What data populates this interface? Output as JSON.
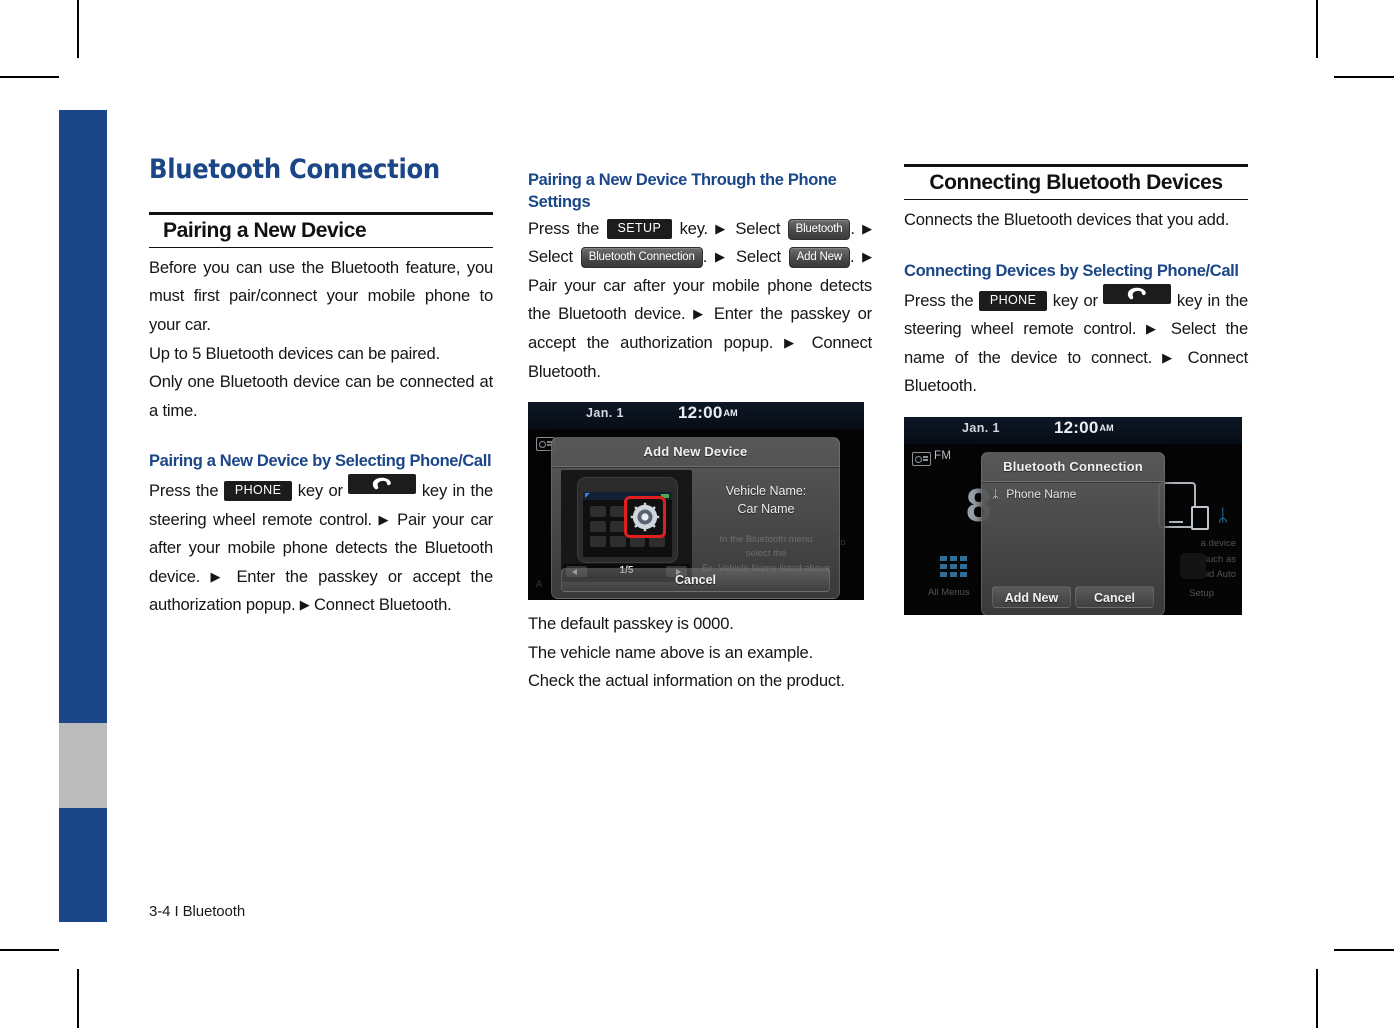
{
  "page": {
    "footer": "3-4 I Bluetooth",
    "accent_blue": "#1b4687",
    "marker_gray": "#bcbcbc"
  },
  "col1": {
    "chapter_title": "Bluetooth Connection",
    "section_title": "Pairing a New Device",
    "intro_p1": "Before you can use the Bluetooth feature, you must first pair/connect your mobile phone to your car.",
    "intro_p2": "Up to 5 Bluetooth devices can be paired.",
    "intro_p3": "Only one Bluetooth device can be connected at a time.",
    "sub_head": "Pairing a New Device by Selecting Phone/Call",
    "steps": {
      "press_the": "Press the ",
      "phone_key": "PHONE",
      "key_or": " key or ",
      "call_icon": "phone-handset-icon",
      "key_in_rest": " key in the steering wheel remote  control. ",
      "arrow": "▶",
      "step2": " Pair your car after your mobile phone detects the Bluetooth device. ",
      "step3": " Enter the passkey or accept the authorization popup. ",
      "step4": " Connect Bluetooth."
    }
  },
  "col2": {
    "sub_head": "Pairing a New Device Through the Phone Settings",
    "steps": {
      "press_the": "Press the ",
      "setup_key": "SETUP",
      "key_select": " key. ",
      "arrow": "▶",
      "select1": " Select ",
      "bluetooth_badge": "Bluetooth",
      "dot1": ". ",
      "select2": " Select ",
      "bt_connection_badge": "Bluetooth Connection",
      "dot2": ". ",
      "select3": " Select ",
      "add_new_badge": "Add New",
      "dot3": ". ",
      "step_pair": " Pair your car after your mobile phone detects the Bluetooth device. ",
      "step_passkey": " Enter the passkey or accept the authorization popup. ",
      "step_connect": " Connect Bluetooth."
    },
    "screenshot": {
      "name": "add-new-device-screen",
      "status_date": "Jan.   1",
      "status_time": "12:00",
      "status_ampm": "AM",
      "modal_title": "Add New Device",
      "vehicle_label": "Vehicle Name:",
      "vehicle_value": "Car Name",
      "faded_line1": "In the Bluetooth menu",
      "faded_line2": "select the",
      "faded_line3": "Ex. Vehicle Name listed above",
      "pager": "1/5",
      "cancel": "Cancel",
      "bg_right_line1": "s",
      "bg_right_line2": "uto",
      "bg_left": "A"
    },
    "note1": "The default passkey is 0000.",
    "note2": "The vehicle name above is an example.",
    "note3": "Check the actual information on the product."
  },
  "col3": {
    "section_title": "Connecting Bluetooth Devices",
    "intro": "Connects the Bluetooth devices that you add.",
    "sub_head": "Connecting Devices by Selecting Phone/Call",
    "steps": {
      "press_the": "Press the ",
      "phone_key": "PHONE",
      "key_or": " key or ",
      "call_icon": "phone-handset-icon",
      "key_in_rest": " key in the steering wheel remote  control. ",
      "arrow": "▶",
      "step2": " Select the name of the device to connect. ",
      "step3": " Connect Bluetooth."
    },
    "screenshot": {
      "name": "bluetooth-connection-screen",
      "status_date": "Jan.   1",
      "status_time": "12:00",
      "status_ampm": "AM",
      "fm_label": "FM",
      "preset": "8",
      "modal_title": "Bluetooth Connection",
      "device_name": "Phone Name",
      "bt_glyph": "ᛦ",
      "btn_add_new": "Add New",
      "btn_cancel": "Cancel",
      "bg_desc_line1": "a device",
      "bg_desc_line2": "es such as",
      "bg_desc_line3": "Android Auto",
      "all_menus": "All Menus",
      "setup": "Setup"
    }
  }
}
